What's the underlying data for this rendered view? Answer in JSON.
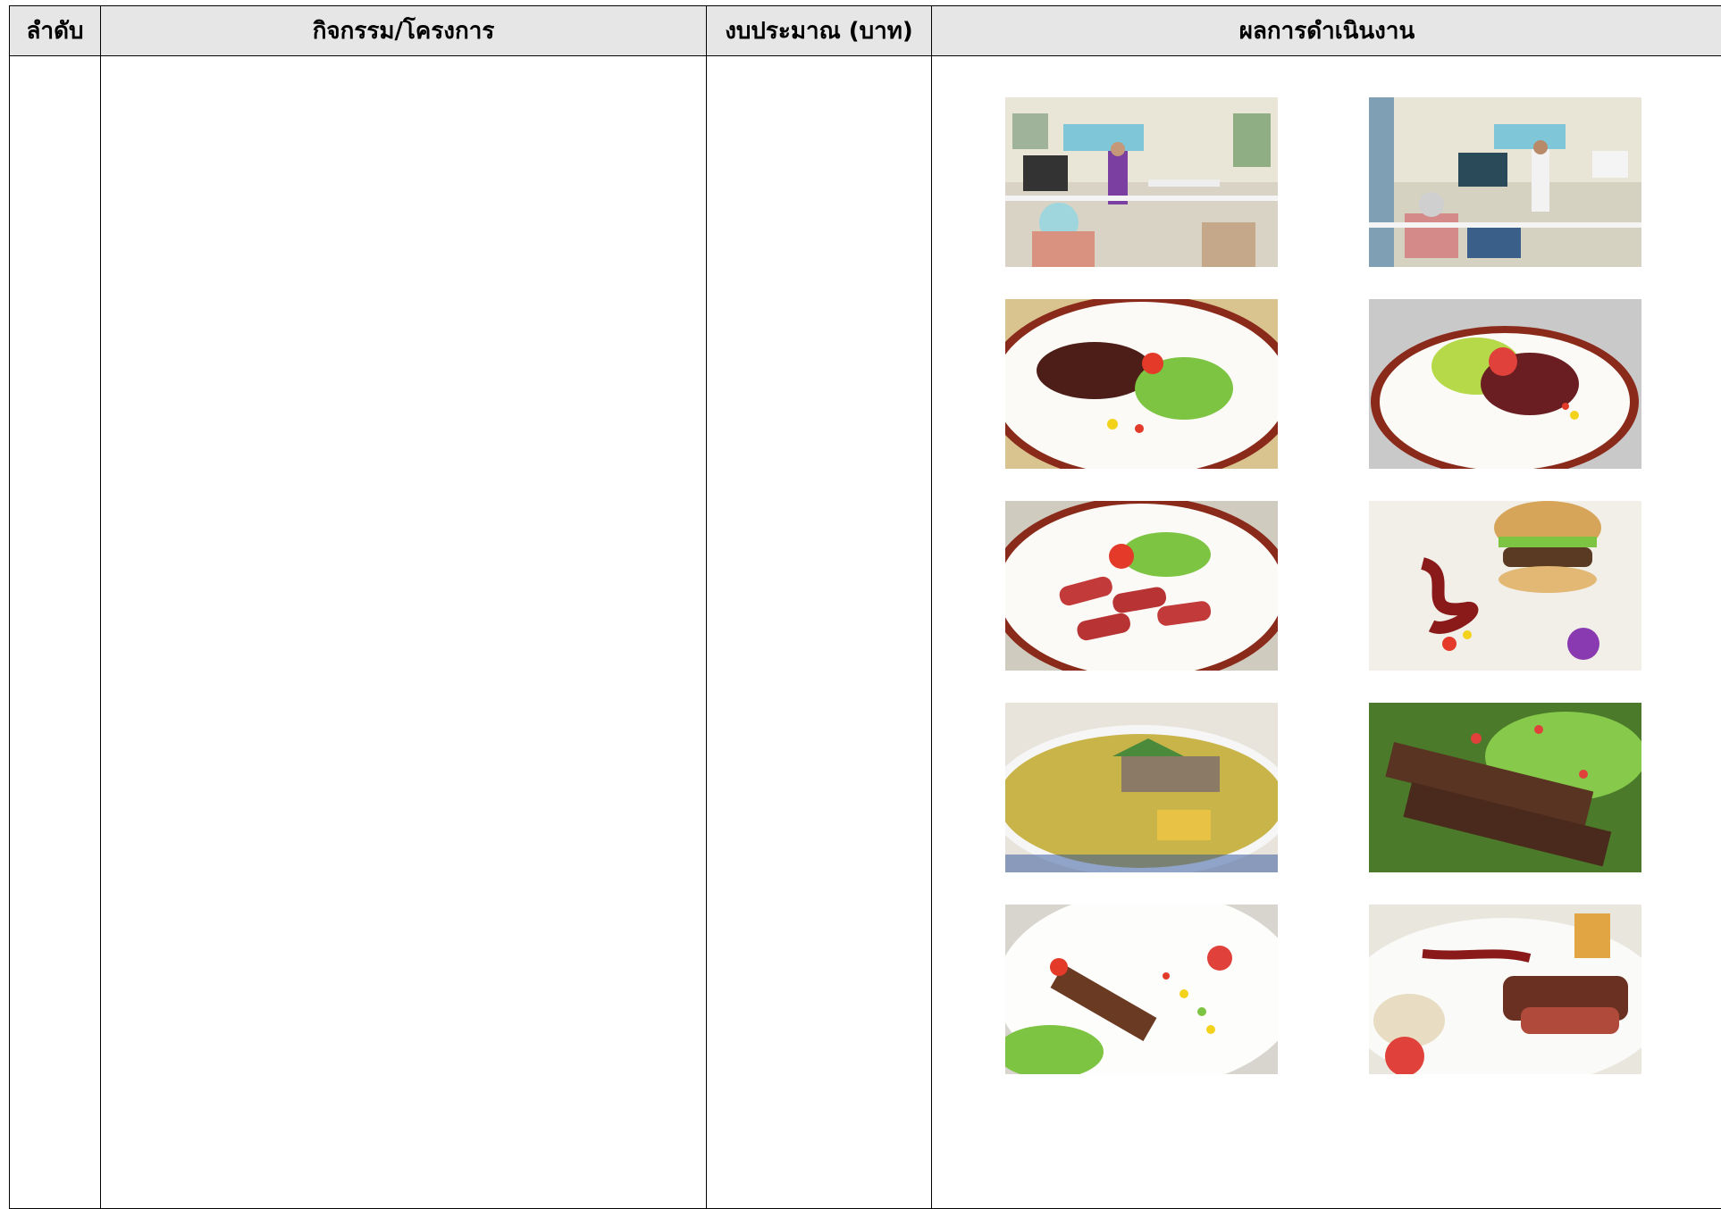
{
  "table": {
    "headers": {
      "no": "ลำดับ",
      "activity": "กิจกรรม/โครงการ",
      "budget": "งบประมาณ (บาท)",
      "result": "ผลการดำเนินงาน"
    }
  },
  "photos": [
    {
      "subject": "training-room-speaker"
    },
    {
      "subject": "training-room-presenter"
    },
    {
      "subject": "dried-beef-salad-plate"
    },
    {
      "subject": "dried-beef-plate-2"
    },
    {
      "subject": "sausage-plate"
    },
    {
      "subject": "burger-plate"
    },
    {
      "subject": "beef-soup-bowl"
    },
    {
      "subject": "grilled-beef-skewers"
    },
    {
      "subject": "beef-kebab-plate"
    },
    {
      "subject": "steak-plate"
    }
  ]
}
